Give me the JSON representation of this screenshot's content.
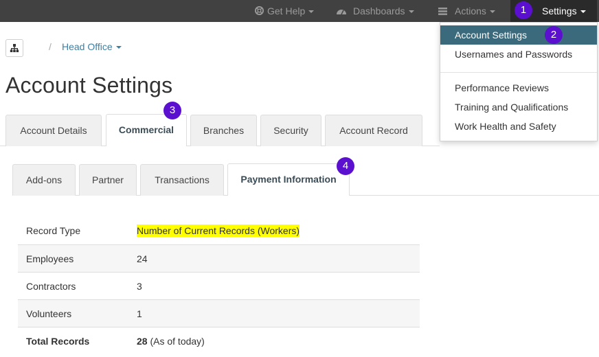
{
  "navbar": {
    "get_help": "Get Help",
    "dashboards": "Dashboards",
    "actions": "Actions",
    "settings": "Settings"
  },
  "badges": [
    "1",
    "2",
    "3",
    "4"
  ],
  "settings_menu": {
    "items": [
      "Account Settings",
      "Usernames and Passwords",
      "Performance Reviews",
      "Training and Qualifications",
      "Work Health and Safety"
    ],
    "active": "Account Settings"
  },
  "breadcrumb": {
    "separator": "/",
    "office": "Head Office"
  },
  "page_title": "Account Settings",
  "main_tabs": [
    "Account Details",
    "Commercial",
    "Branches",
    "Security",
    "Account Record"
  ],
  "main_tab_active": "Commercial",
  "sub_tabs": [
    "Add-ons",
    "Partner",
    "Transactions",
    "Payment Information"
  ],
  "sub_tab_active": "Payment Information",
  "records_table": {
    "header": {
      "label": "Record Type",
      "value": "Number of Current Records (Workers)"
    },
    "rows": [
      {
        "label": "Employees",
        "value": "24"
      },
      {
        "label": "Contractors",
        "value": "3"
      },
      {
        "label": "Volunteers",
        "value": "1"
      }
    ],
    "total": {
      "label": "Total Records",
      "value": "28",
      "note": "(As of today)"
    }
  },
  "colors": {
    "navbar": "#414141",
    "badge": "#5b10d0",
    "menu_active": "#3b6a7d",
    "link": "#3d7fa3",
    "highlight": "#ffff00"
  }
}
